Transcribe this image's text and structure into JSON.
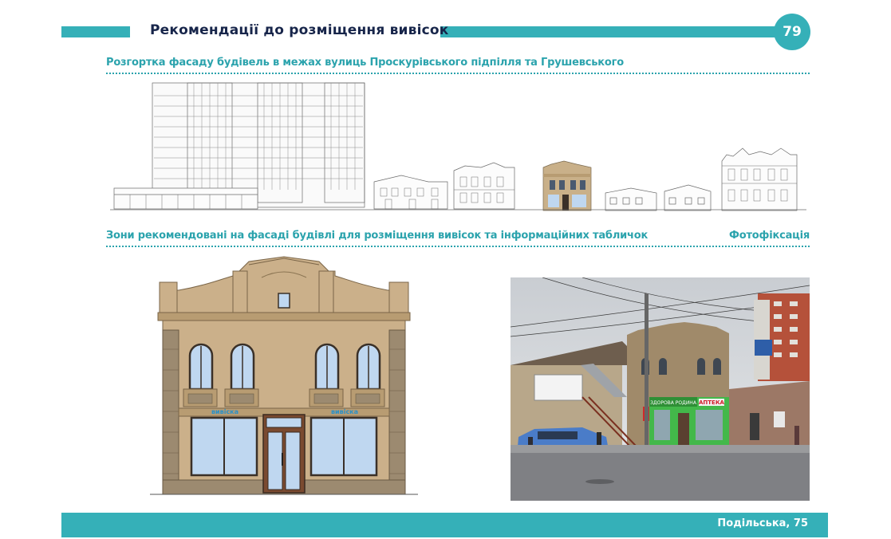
{
  "header": {
    "title": "Рекомендації до розміщення вивісок",
    "page_number": "79"
  },
  "section1": {
    "heading": "Розгортка фасаду будівель в межах вулиць Проскурівського підпілля та Грушевського"
  },
  "section2": {
    "heading": "Зони рекомендовані на фасаді будівлі для розміщення вивісок та інформаційних табличок",
    "photo_heading": "Фотофіксація"
  },
  "facade": {
    "sign_left": "вивіска",
    "sign_right": "вивіска"
  },
  "photo": {
    "store_sign": "ЗДОРОВА РОДИНА",
    "pharmacy_sign": "АПТЕКА"
  },
  "footer": {
    "address": "Подільська, 75"
  },
  "colors": {
    "accent": "#35b0b8",
    "title": "#17254a",
    "facade": "#cbb08a",
    "stone": "#9c8a70"
  }
}
